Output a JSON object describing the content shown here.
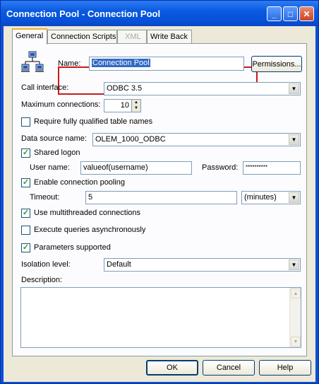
{
  "window": {
    "title": "Connection Pool - Connection Pool"
  },
  "tabs": [
    {
      "label": "General"
    },
    {
      "label": "Connection Scripts"
    },
    {
      "label": "XML"
    },
    {
      "label": "Write Back"
    }
  ],
  "form": {
    "name_label": "Name:",
    "name_value": "Connection Pool",
    "permissions_button": "Permissions...",
    "call_interface_label": "Call interface:",
    "call_interface_value": "ODBC 3.5",
    "max_connections_label": "Maximum connections:",
    "max_connections_value": "10",
    "require_qualified_label": "Require fully qualified table names",
    "data_source_label": "Data source name:",
    "data_source_value": "OLEM_1000_ODBC",
    "shared_logon_label": "Shared logon",
    "user_name_label": "User name:",
    "user_name_value": "valueof(username)",
    "password_label": "Password:",
    "password_value": "**********",
    "enable_pooling_label": "Enable connection pooling",
    "timeout_label": "Timeout:",
    "timeout_value": "5",
    "timeout_unit": "(minutes)",
    "multithreaded_label": "Use multithreaded connections",
    "async_label": "Execute queries asynchronously",
    "parameters_label": "Parameters supported",
    "isolation_label": "Isolation level:",
    "isolation_value": "Default",
    "description_label": "Description:"
  },
  "checkboxes": {
    "require_qualified": false,
    "shared_logon": true,
    "enable_pooling": true,
    "multithreaded": true,
    "async": false,
    "parameters": true
  },
  "buttons": {
    "ok": "OK",
    "cancel": "Cancel",
    "help": "Help"
  },
  "title_buttons": {
    "minimize": "_",
    "maximize": "□",
    "close": "✕"
  }
}
